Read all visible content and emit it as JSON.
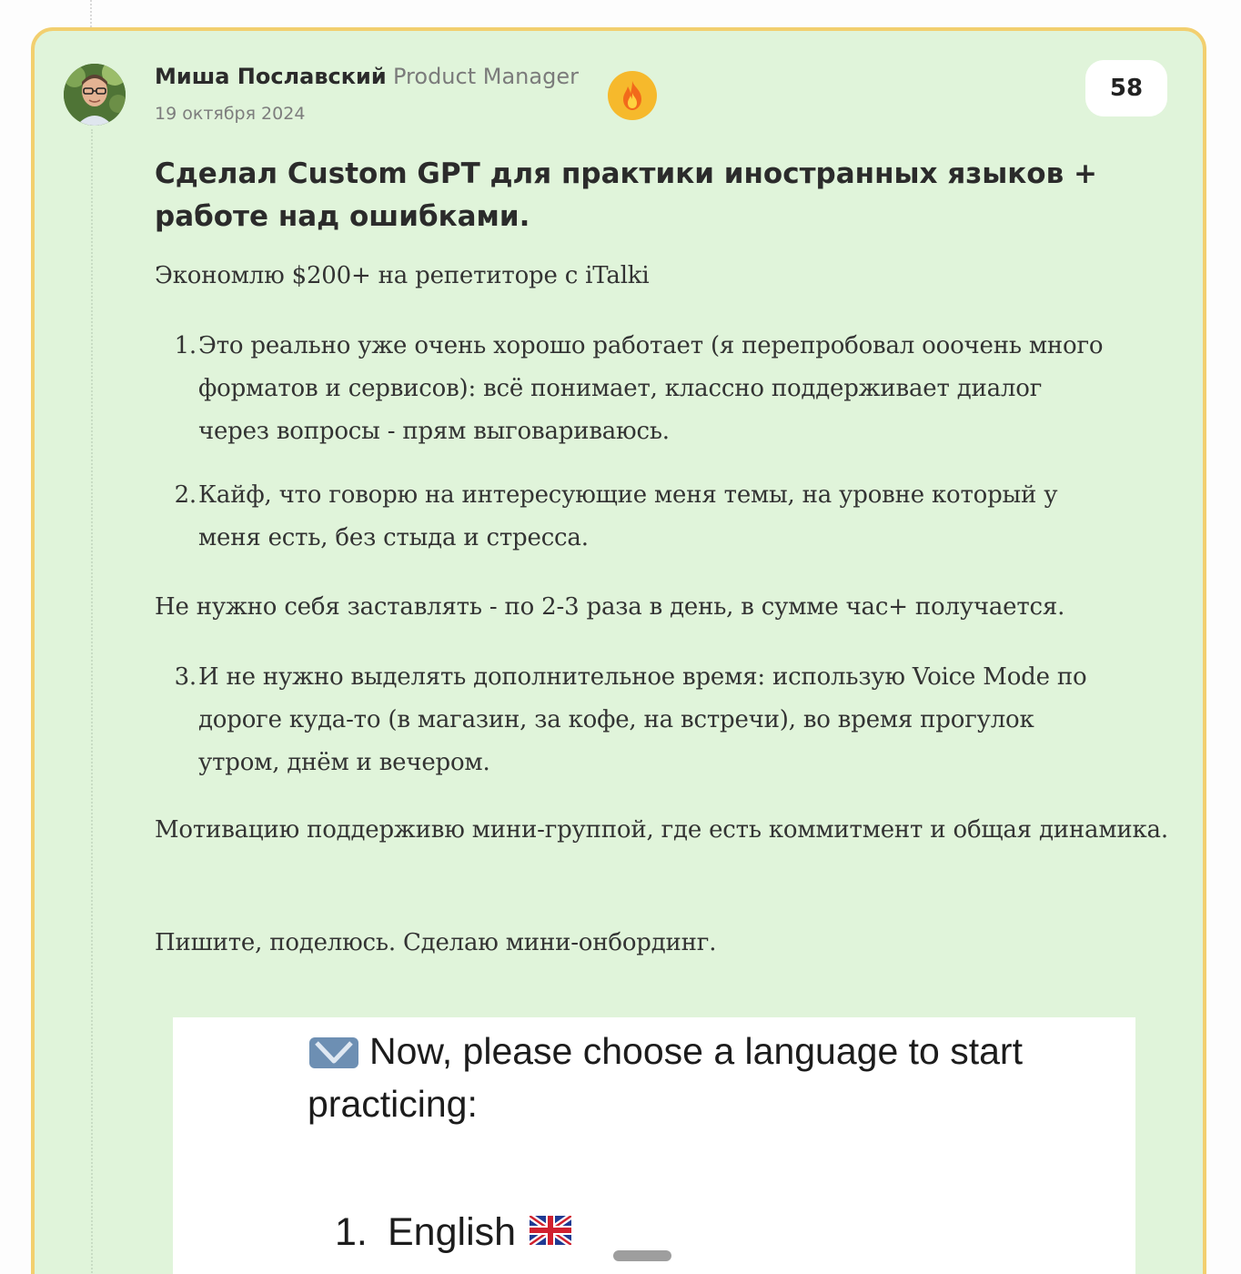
{
  "post": {
    "author": {
      "name": "Миша Пославский",
      "role": "Product Manager"
    },
    "date": "19 октября 2024",
    "badge_icon": "fire-icon",
    "upvotes": "58",
    "title": "Сделал Custom GPT для практики иностранных языков + работе над ошибками.",
    "intro": "Экономлю $200+ на репетиторе с iTalki",
    "list_a": [
      {
        "num": "1.",
        "text": "Это реально уже очень хорошо работает (я перепробовал ооочень много форматов и сервисов): всё понимает, классно поддерживает диалог через вопросы - прям выговариваюсь."
      },
      {
        "num": "2.",
        "text": "Кайф, что говорю на интересующие меня темы, на уровне который у меня есть, без стыда и стресса."
      }
    ],
    "middle": "Не нужно себя заставлять - по 2-3 раза в день, в сумме час+ получается.",
    "list_b": [
      {
        "num": "3.",
        "text": "И не нужно выделять дополнительное время: использую Voice Mode по дороге куда-то (в магазин, за кофе, на встречи), во время прогулок утром, днём и вечером."
      }
    ],
    "motivation": "Мотивацию поддерживю мини-группой, где есть коммитмент и общая динамика.",
    "closing": "Пишите, поделюсь. Сделаю мини-онбординг.",
    "embed": {
      "icon": "checkmark-icon",
      "prompt": "Now, please choose a language to start practicing:",
      "options": [
        {
          "num": "1.",
          "label": "English",
          "flag_icon": "uk-flag-icon"
        }
      ]
    }
  },
  "colors": {
    "card_background": "#e0f4da",
    "card_border": "#f2cf6f",
    "badge": "#f6b92c",
    "text": "#333333",
    "muted": "#7b7b7b"
  }
}
